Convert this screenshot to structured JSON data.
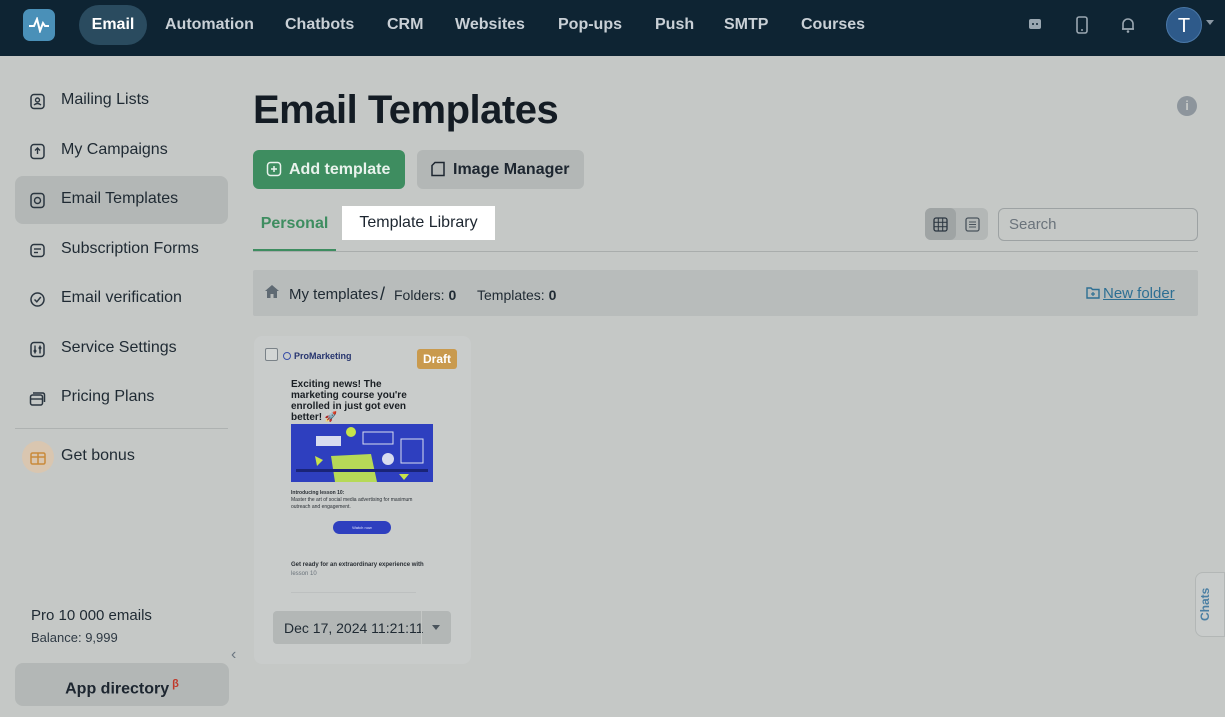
{
  "nav": {
    "items": [
      "Email",
      "Automation",
      "Chatbots",
      "CRM",
      "Websites",
      "Pop-ups",
      "Push",
      "SMTP",
      "Courses"
    ],
    "avatar_initial": "T",
    "icons": [
      "chat-icon",
      "mobile-icon",
      "bell-icon"
    ]
  },
  "sidebar": {
    "items": [
      {
        "label": "Mailing Lists",
        "icon": "contacts-icon"
      },
      {
        "label": "My Campaigns",
        "icon": "upload-icon"
      },
      {
        "label": "Email Templates",
        "icon": "templates-icon",
        "active": true
      },
      {
        "label": "Subscription Forms",
        "icon": "form-icon"
      },
      {
        "label": "Email verification",
        "icon": "check-circle-icon"
      },
      {
        "label": "Service Settings",
        "icon": "settings-sliders-icon"
      },
      {
        "label": "Pricing Plans",
        "icon": "cards-icon"
      }
    ],
    "bonus_label": "Get bonus",
    "plan_name": "Pro 10 000 emails",
    "balance": "Balance: 9,999",
    "app_directory": "App directory",
    "app_directory_sup": "β"
  },
  "main": {
    "title": "Email Templates",
    "add_button": "Add template",
    "image_manager_button": "Image Manager",
    "tabs": {
      "personal": "Personal",
      "library": "Template Library"
    },
    "search": {
      "placeholder": "Search",
      "value": ""
    },
    "breadcrumb": {
      "root": "My templates",
      "separator": "/",
      "folders_label": "Folders:",
      "folders_count": "0",
      "templates_label": "Templates:",
      "templates_count": "0",
      "new_folder": "New folder"
    },
    "card": {
      "badge": "Draft",
      "brand": "ProMarketing",
      "headline": "Exciting news! The marketing course you're enrolled in just got even better! 🚀",
      "sub_title": "Introducing lesson 10:",
      "sub_text": "Master the art of social media advertising for maximum outreach and engagement.",
      "cta": "Watch now",
      "footer_text": "Get ready for an extraordinary experience with",
      "footer_muted": "lesson 10",
      "date": "Dec 17, 2024 11:21:11"
    }
  },
  "chats_tab": "Chats",
  "colors": {
    "topbar": "#0e2433",
    "accent_green": "#3e8d60",
    "link_blue": "#2d6f93",
    "draft": "#c99a4e"
  }
}
